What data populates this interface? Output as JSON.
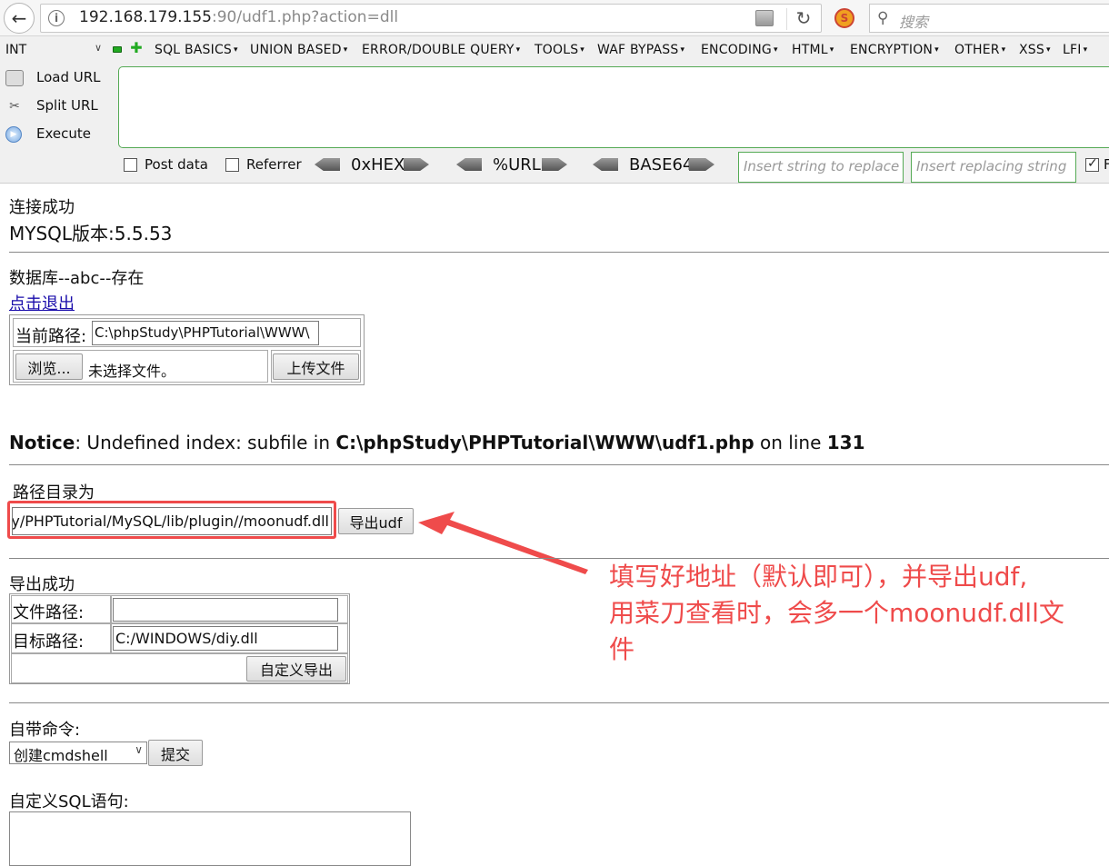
{
  "browser": {
    "url_host": "192.168.179.155",
    "url_rest": ":90/udf1.php?action=dll",
    "search_placeholder": "搜索"
  },
  "hackbar": {
    "type_select": "INT",
    "menus": [
      "SQL BASICS",
      "UNION BASED",
      "ERROR/DOUBLE QUERY",
      "TOOLS",
      "WAF BYPASS",
      "ENCODING",
      "HTML",
      "ENCRYPTION",
      "OTHER",
      "XSS",
      "LFI"
    ],
    "load_url": "Load URL",
    "split_url": "Split URL",
    "execute": "Execute",
    "post_data": "Post data",
    "referrer": "Referrer",
    "hex": "0xHEX",
    "urlenc": "%URL",
    "base64": "BASE64",
    "replace_placeholder": "Insert string to replace",
    "replacing_placeholder": "Insert replacing string"
  },
  "page": {
    "connect_ok": "连接成功",
    "mysql_version": "MYSQL版本:5.5.53",
    "db_status": "数据库--abc--存在",
    "logout_link": "点击退出",
    "current_path_label": "当前路径:",
    "current_path_value": "C:\\phpStudy\\PHPTutorial\\WWW\\",
    "browse_button": "浏览...",
    "no_file": "未选择文件。",
    "upload_button": "上传文件",
    "notice_label": "Notice",
    "notice_text": ": Undefined index: subfile in ",
    "notice_path": "C:\\phpStudy\\PHPTutorial\\WWW\\udf1.php",
    "notice_on_line": " on line ",
    "notice_line": "131",
    "dir_label": "路径目录为",
    "dir_value": "udy/PHPTutorial/MySQL/lib/plugin//moonudf.dll",
    "export_udf_button": "导出udf",
    "export_ok": "导出成功",
    "file_path_label": "文件路径:",
    "file_path_value": "",
    "target_path_label": "目标路径:",
    "target_path_value": "C:/WINDOWS/diy.dll",
    "custom_export_button": "自定义导出",
    "builtin_cmd_label": "自带命令:",
    "cmd_select": "创建cmdshell",
    "submit_button": "提交",
    "custom_sql_label": "自定义SQL语句:"
  },
  "annotation": {
    "line1": "填写好地址（默认即可），并导出udf,",
    "line2": "用菜刀查看时，会多一个moonudf.dll文",
    "line3": "件",
    "color": "#ef4b4b"
  }
}
